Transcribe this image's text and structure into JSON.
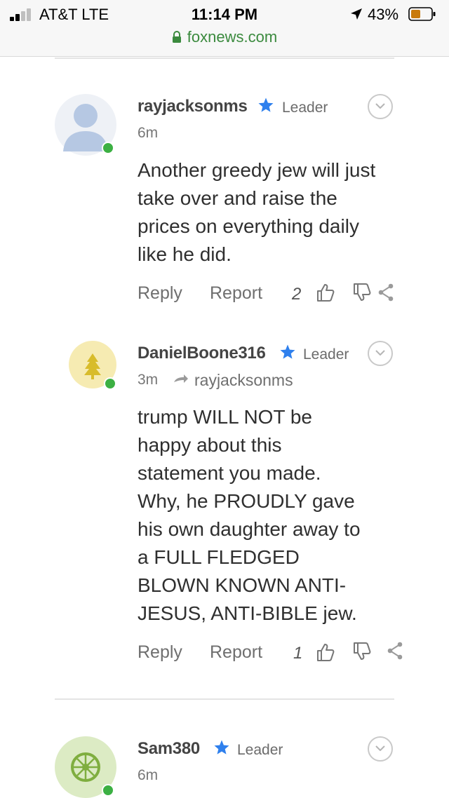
{
  "status_bar": {
    "carrier": "AT&T   LTE",
    "time": "11:14 PM",
    "battery": "43%"
  },
  "browser": {
    "url": "foxnews.com"
  },
  "comments": [
    {
      "username": "rayjacksonms",
      "badge": "Leader",
      "time": "6m",
      "reply_to": "",
      "text": "Another greedy jew will just take over and raise the prices on everything daily like he did.",
      "reply_label": "Reply",
      "report_label": "Report",
      "upvotes": "2"
    },
    {
      "username": "DanielBoone316",
      "badge": "Leader",
      "time": "3m",
      "reply_to": "rayjacksonms",
      "text": "trump WILL NOT be happy about this statement you made. Why, he PROUDLY gave his own daughter away to a FULL FLEDGED BLOWN KNOWN ANTI-JESUS, ANTI-BIBLE jew.",
      "reply_label": "Reply",
      "report_label": "Report",
      "upvotes": "1"
    },
    {
      "username": "Sam380",
      "badge": "Leader",
      "time": "6m",
      "reply_to": "",
      "text": "",
      "reply_label": "",
      "report_label": "",
      "upvotes": ""
    }
  ],
  "colors": {
    "online": "#3cb043",
    "star": "#2f80ed",
    "url": "#3b8a3e",
    "battery_fill": "#c97a0b"
  },
  "icons": [
    "signal-icon",
    "location-arrow-icon",
    "battery-icon",
    "lock-icon",
    "star-icon",
    "chevron-down-icon",
    "thumbs-up-icon",
    "thumbs-down-icon",
    "share-icon",
    "reply-arrow-icon",
    "tree-icon",
    "wheel-icon",
    "default-user-icon"
  ]
}
